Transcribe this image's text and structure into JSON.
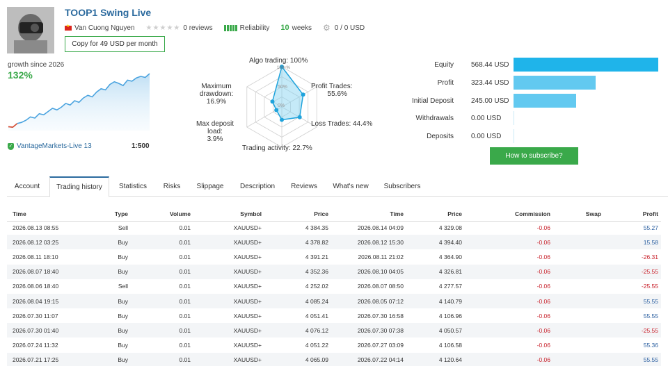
{
  "header": {
    "title": "TOOP1 Swing Live",
    "author": "Van Cuong Nguyen",
    "reviews": "0 reviews",
    "reliability_label": "Reliability",
    "weeks_value": "10",
    "weeks_label": "weeks",
    "subscribers": "0 / 0 USD",
    "copy_button": "Copy for 49 USD per month"
  },
  "growth": {
    "label": "growth since 2026",
    "value": "132%",
    "broker": "VantageMarkets-Live 13",
    "leverage": "1:500",
    "curve": [
      0.02,
      0.01,
      0.08,
      0.1,
      0.14,
      0.2,
      0.18,
      0.26,
      0.24,
      0.3,
      0.36,
      0.33,
      0.38,
      0.45,
      0.42,
      0.5,
      0.47,
      0.55,
      0.6,
      0.57,
      0.66,
      0.72,
      0.7,
      0.8,
      0.85,
      0.82,
      0.78,
      0.88,
      0.86,
      0.92,
      0.95,
      0.93,
      1.0
    ]
  },
  "radar": {
    "labels": {
      "algo": "Algo trading: 100%",
      "profit_trades_1": "Profit Trades:",
      "profit_trades_2": "55.6%",
      "loss_trades": "Loss Trades: 44.4%",
      "activity": "Trading activity: 22.7%",
      "deposit_load_1": "Max deposit load:",
      "deposit_load_2": "3.9%",
      "drawdown_1": "Maximum",
      "drawdown_2": "drawdown: 16.9%",
      "ring_100": "100+%",
      "ring_50": "50%",
      "ring_0": "0%"
    },
    "values": {
      "algo": 1.0,
      "profit": 0.556,
      "loss": 0.444,
      "activity": 0.227,
      "deposit": 0.039,
      "drawdown": 0.169
    }
  },
  "equity": {
    "max": 568.44,
    "rows": [
      {
        "label": "Equity",
        "value": "568.44 USD",
        "amount": 568.44,
        "color": "#1fb4ea"
      },
      {
        "label": "Profit",
        "value": "323.44 USD",
        "amount": 323.44,
        "color": "#62c9f0"
      },
      {
        "label": "Initial Deposit",
        "value": "245.00 USD",
        "amount": 245.0,
        "color": "#62c9f0"
      },
      {
        "label": "Withdrawals",
        "value": "0.00 USD",
        "amount": 0,
        "color": "#62c9f0"
      },
      {
        "label": "Deposits",
        "value": "0.00 USD",
        "amount": 0,
        "color": "#62c9f0"
      }
    ],
    "subscribe_button": "How to subscribe?"
  },
  "tabs": [
    "Account",
    "Trading history",
    "Statistics",
    "Risks",
    "Slippage",
    "Description",
    "Reviews",
    "What's new",
    "Subscribers"
  ],
  "table": {
    "headers": [
      "Time",
      "Type",
      "Volume",
      "Symbol",
      "Price",
      "Time",
      "Price",
      "Commission",
      "Swap",
      "Profit"
    ],
    "rows": [
      [
        "2026.08.13 08:55",
        "Sell",
        "0.01",
        "XAUUSD+",
        "4 384.35",
        "2026.08.14 04:09",
        "4 329.08",
        "-0.06",
        "",
        "55.27"
      ],
      [
        "2026.08.12 03:25",
        "Buy",
        "0.01",
        "XAUUSD+",
        "4 378.82",
        "2026.08.12 15:30",
        "4 394.40",
        "-0.06",
        "",
        "15.58"
      ],
      [
        "2026.08.11 18:10",
        "Buy",
        "0.01",
        "XAUUSD+",
        "4 391.21",
        "2026.08.11 21:02",
        "4 364.90",
        "-0.06",
        "",
        "-26.31"
      ],
      [
        "2026.08.07 18:40",
        "Buy",
        "0.01",
        "XAUUSD+",
        "4 352.36",
        "2026.08.10 04:05",
        "4 326.81",
        "-0.06",
        "",
        "-25.55"
      ],
      [
        "2026.08.06 18:40",
        "Sell",
        "0.01",
        "XAUUSD+",
        "4 252.02",
        "2026.08.07 08:50",
        "4 277.57",
        "-0.06",
        "",
        "-25.55"
      ],
      [
        "2026.08.04 19:15",
        "Buy",
        "0.01",
        "XAUUSD+",
        "4 085.24",
        "2026.08.05 07:12",
        "4 140.79",
        "-0.06",
        "",
        "55.55"
      ],
      [
        "2026.07.30 11:07",
        "Buy",
        "0.01",
        "XAUUSD+",
        "4 051.41",
        "2026.07.30 16:58",
        "4 106.96",
        "-0.06",
        "",
        "55.55"
      ],
      [
        "2026.07.30 01:40",
        "Buy",
        "0.01",
        "XAUUSD+",
        "4 076.12",
        "2026.07.30 07:38",
        "4 050.57",
        "-0.06",
        "",
        "-25.55"
      ],
      [
        "2026.07.24 11:32",
        "Buy",
        "0.01",
        "XAUUSD+",
        "4 051.22",
        "2026.07.27 03:09",
        "4 106.58",
        "-0.06",
        "",
        "55.36"
      ],
      [
        "2026.07.21 17:25",
        "Buy",
        "0.01",
        "XAUUSD+",
        "4 065.09",
        "2026.07.22 04:14",
        "4 120.64",
        "-0.06",
        "",
        "55.55"
      ]
    ]
  },
  "colors": {
    "accent_green": "#3aa94a",
    "link_blue": "#2b6a9e",
    "negative": "#c8202a",
    "positive": "#2b5fa0"
  }
}
